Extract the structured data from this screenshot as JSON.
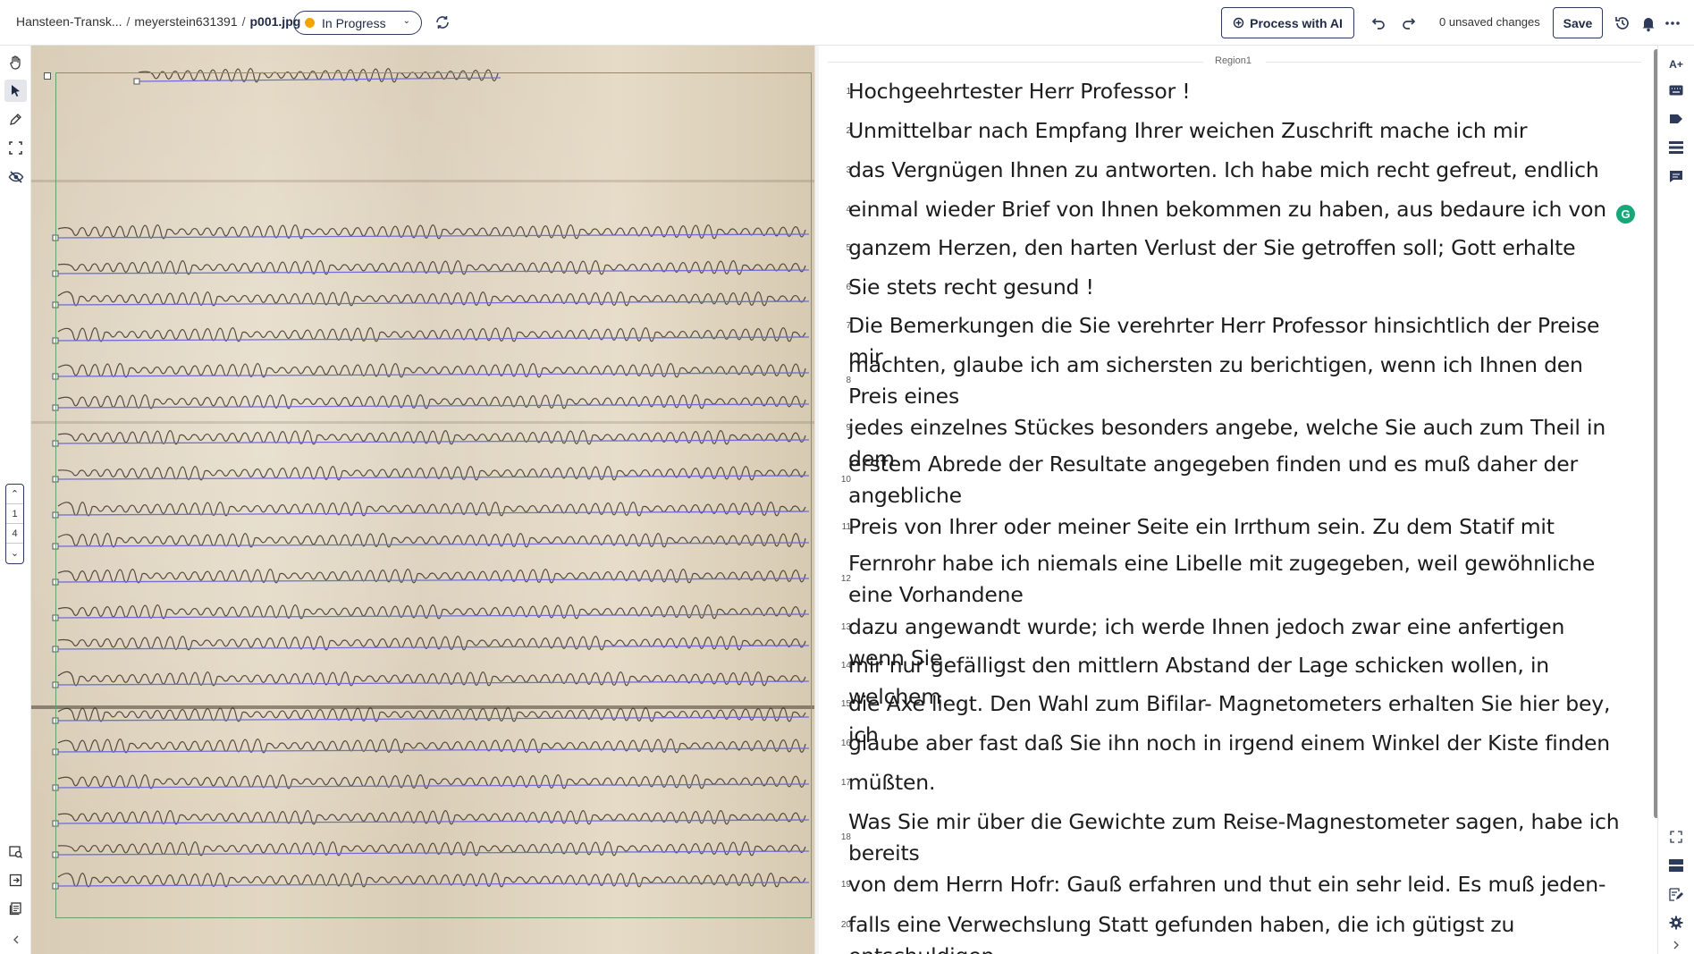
{
  "breadcrumb": {
    "project": "Hansteen-Transk...",
    "collection": "meyerstein631391",
    "file": "p001.jpg",
    "separator": "/"
  },
  "status": {
    "label": "In Progress",
    "color": "#f5a300"
  },
  "toolbar": {
    "process_ai_label": "Process with AI",
    "unsaved_label": "0 unsaved changes",
    "save_label": "Save"
  },
  "pager": {
    "current": "1",
    "total": "4"
  },
  "text_editor": {
    "region_label": "Region1",
    "lines": [
      {
        "num": "1",
        "text": "Hochgeehrtester Herr Professor !"
      },
      {
        "num": "2",
        "text": "Unmittelbar nach Empfang Ihrer weichen Zuschrift mache ich mir"
      },
      {
        "num": "3",
        "text": "das Vergnügen Ihnen zu antworten. Ich habe mich recht gefreut, endlich"
      },
      {
        "num": "4",
        "text": "einmal wieder Brief von Ihnen bekommen zu haben, aus bedaure ich von"
      },
      {
        "num": "5",
        "text": "ganzem Herzen, den harten Verlust der Sie getroffen soll; Gott erhalte"
      },
      {
        "num": "6",
        "text": "Sie stets recht gesund !"
      },
      {
        "num": "7",
        "text": "Die Bemerkungen die Sie verehrter Herr Professor hinsichtlich der Preise mir"
      },
      {
        "num": "8",
        "text": "machten, glaube ich am sichersten zu berichtigen, wenn ich Ihnen den Preis eines"
      },
      {
        "num": "9",
        "text": "jedes einzelnes Stückes besonders angebe, welche Sie auch zum Theil in dem"
      },
      {
        "num": "10",
        "text": "erstem Abrede der Resultate angegeben finden und es muß daher der angebliche"
      },
      {
        "num": "11",
        "text": "Preis von Ihrer oder meiner Seite ein Irrthum sein. Zu dem Statif mit"
      },
      {
        "num": "12",
        "text": "Fernrohr habe ich niemals eine Libelle mit zugegeben, weil gewöhnliche eine Vorhandene"
      },
      {
        "num": "13",
        "text": "dazu angewandt wurde; ich werde Ihnen jedoch zwar eine anfertigen wenn Sie"
      },
      {
        "num": "14",
        "text": "mir nur gefälligst den mittlern Abstand der Lage schicken wollen, in welchem"
      },
      {
        "num": "15",
        "text": "die Axe liegt. Den Wahl zum Bifilar- Magnetometers erhalten Sie hier bey, ich"
      },
      {
        "num": "16",
        "text": "glaube aber fast daß Sie ihn noch in irgend einem Winkel der Kiste finden"
      },
      {
        "num": "17",
        "text": "müßten."
      },
      {
        "num": "18",
        "text": "Was Sie mir über die Gewichte zum Reise-Magnestometer sagen, habe ich bereits"
      },
      {
        "num": "19",
        "text": "von dem Herrn Hofr: Gauß erfahren und thut ein sehr leid. Es muß jeden-"
      },
      {
        "num": "20",
        "text": "falls eine Verwechslung Statt gefunden haben, die ich gütigst zu entschuldigen"
      }
    ]
  },
  "colors": {
    "accent": "#2d3a5a",
    "region_border": "#6aa06a",
    "baseline": "#6f6cd6",
    "spell_underline": "#e6b450"
  },
  "icons": {
    "top": [
      "sync-icon",
      "sparkle-icon",
      "undo-icon",
      "redo-icon",
      "history-icon",
      "bell-icon",
      "more-icon"
    ],
    "left": [
      "hand-icon",
      "pointer-icon",
      "pen-icon",
      "crop-icon",
      "eye-off-icon",
      "image-search-icon",
      "import-icon",
      "layers-icon",
      "chevron-left-icon"
    ],
    "right": [
      "font-size-icon",
      "keyboard-icon",
      "tag-icon",
      "list-icon",
      "comment-icon",
      "fullscreen-icon",
      "layout-icon",
      "edit-icon",
      "settings-icon",
      "chevron-right-icon"
    ]
  }
}
